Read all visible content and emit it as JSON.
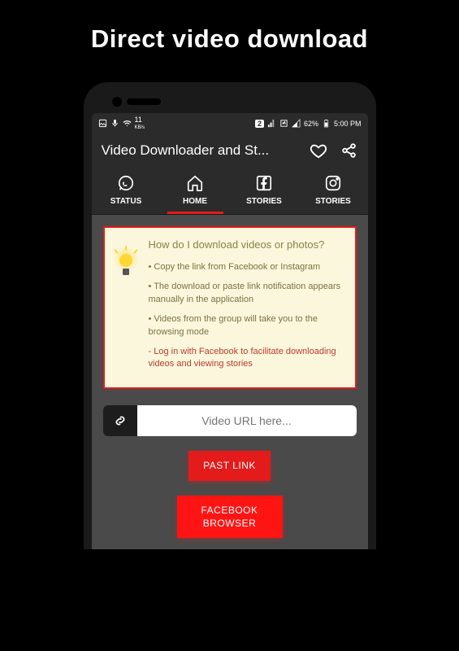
{
  "promo": {
    "title": "Direct video download"
  },
  "statusBar": {
    "dataRate": "11",
    "dataUnit": "KB/s",
    "simBadge": "2",
    "battery": "62%",
    "time": "5:00 PM"
  },
  "appBar": {
    "title": "Video Downloader and St..."
  },
  "tabs": {
    "items": [
      {
        "label": "STATUS"
      },
      {
        "label": "HOME"
      },
      {
        "label": "STORIES"
      },
      {
        "label": "STORIES"
      }
    ]
  },
  "infoCard": {
    "title": "How do I download videos or photos?",
    "items": [
      "• Copy the link from Facebook or Instagram",
      "• The download or paste link notification appears manually in the application",
      "• Videos from the group will take you to the browsing mode"
    ],
    "login": "- Log in with Facebook to facilitate downloading videos and viewing stories"
  },
  "urlInput": {
    "placeholder": "Video URL here..."
  },
  "buttons": {
    "pastLink": "PAST LINK",
    "fbBrowser": "FACEBOOK\nBROWSER"
  }
}
